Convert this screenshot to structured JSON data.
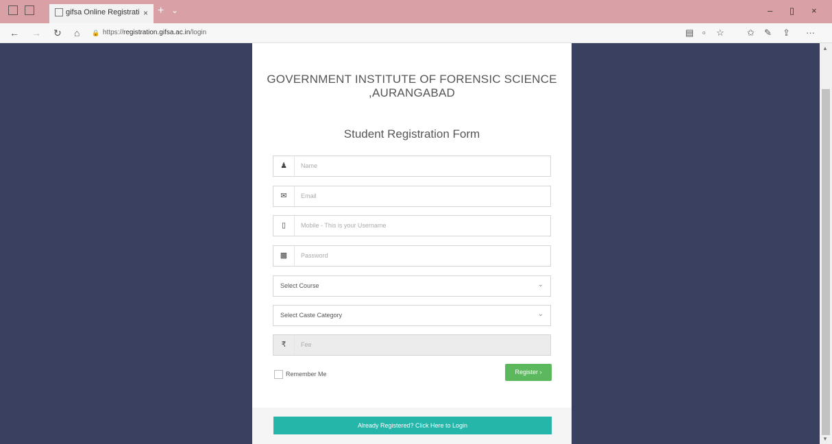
{
  "browser": {
    "tab_title": "gifsa Online Registrati",
    "tab_close": "×",
    "new_tab": "+",
    "tab_dropdown": "⌄",
    "url_prefix": "https://",
    "url_host": "registration.gifsa.ac.in",
    "url_path": "/login",
    "minimize": "–",
    "maximize": "▯",
    "close": "×",
    "back": "←",
    "forward": "→",
    "refresh": "↻",
    "home": "⌂",
    "lock": "🔒",
    "more": "···"
  },
  "page": {
    "institute_title": "GOVERNMENT INSTITUTE OF FORENSIC SCIENCE ,AURANGABAD",
    "form_title": "Student Registration Form",
    "fields": {
      "name_placeholder": "Name",
      "email_placeholder": "Email",
      "mobile_placeholder": "Mobile - This is your Username",
      "password_placeholder": "Password",
      "fee_placeholder": "Fee"
    },
    "selects": {
      "course": "Select Course",
      "caste": "Select Caste Category"
    },
    "remember_label": "Remember Me",
    "register_button": "Register ›",
    "login_button": "Already Registered? Click Here to Login"
  },
  "colors": {
    "background": "#3a4160",
    "register": "#5cb85c",
    "login": "#26b5a9"
  }
}
